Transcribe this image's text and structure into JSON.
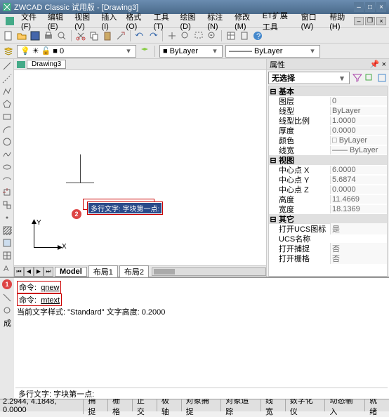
{
  "title": "ZWCAD Classic 试用版 - [Drawing3]",
  "menus": [
    "文件(F)",
    "编辑(E)",
    "视图(V)",
    "插入(I)",
    "格式(O)",
    "工具(T)",
    "绘图(D)",
    "标注(N)",
    "修改(M)",
    "ET扩展工具",
    "窗口(W)",
    "帮助(H)"
  ],
  "tab_name": "Drawing3",
  "layer_dropdown": "0",
  "color_dropdown": "ByLayer",
  "linetype_dropdown": "ByLayer",
  "model_tabs": [
    "Model",
    "布局1",
    "布局2"
  ],
  "hint_text": "多行文字: 字块第一点:",
  "axis_y": "Y",
  "axis_x": "X",
  "marker1": "1",
  "marker2": "2",
  "cmd": {
    "line1_label": "命令: ",
    "line1_val": "qnew",
    "line2_label": "命令: ",
    "line2_val": "mtext",
    "line3": "当前文字样式: \"Standard\" 文字高度: 0.2000"
  },
  "cmd_prompt": "多行文字: 字块第一点:",
  "props": {
    "title": "属性",
    "selection": "无选择",
    "cats": {
      "basic": "基本",
      "view": "视图",
      "misc": "其它"
    },
    "rows": [
      {
        "k": "图层",
        "v": "0"
      },
      {
        "k": "线型",
        "v": "ByLayer"
      },
      {
        "k": "线型比例",
        "v": "1.0000"
      },
      {
        "k": "厚度",
        "v": "0.0000"
      },
      {
        "k": "颜色",
        "v": "□ ByLayer"
      },
      {
        "k": "线宽",
        "v": "—— ByLayer"
      },
      {
        "k": "中心点 X",
        "v": "6.0000"
      },
      {
        "k": "中心点 Y",
        "v": "5.6874"
      },
      {
        "k": "中心点 Z",
        "v": "0.0000"
      },
      {
        "k": "高度",
        "v": "11.4669"
      },
      {
        "k": "宽度",
        "v": "18.1369"
      },
      {
        "k": "打开UCS图标",
        "v": "是"
      },
      {
        "k": "UCS名称",
        "v": ""
      },
      {
        "k": "打开捕捉",
        "v": "否"
      },
      {
        "k": "打开栅格",
        "v": "否"
      }
    ]
  },
  "status": {
    "coord": "2.2944, 4.1848, 0.0000",
    "btns": [
      "捕捉",
      "栅格",
      "正交",
      "极轴",
      "对象捕捉",
      "对象追踪",
      "线宽",
      "数字化仪",
      "动态输入",
      "就绪"
    ]
  }
}
